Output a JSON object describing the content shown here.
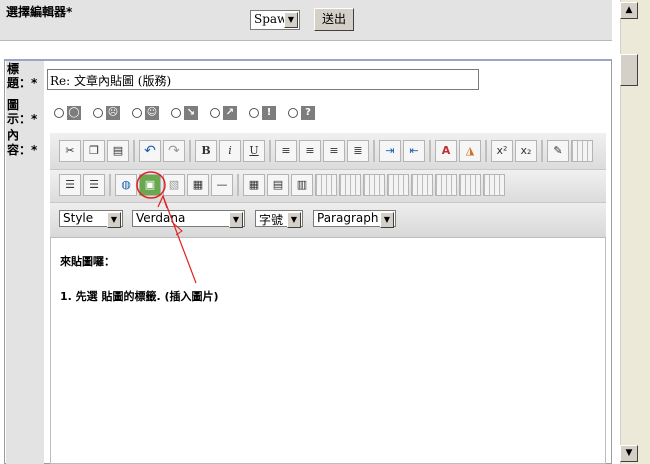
{
  "editor_row": {
    "label": "選擇編輯器*",
    "selected_editor": "Spaw",
    "submit_label": "送出"
  },
  "form": {
    "title_label_1": "標",
    "title_label_2": "題：*",
    "icon_label_1": "圖",
    "icon_label_2": "示：*",
    "content_label_1": "內",
    "content_label_2": "容：*",
    "title_value": "Re: 文章內貼圖 (版務)"
  },
  "icon_options": [
    "smile-face",
    "sad-face",
    "happy-face",
    "arrow-down-right",
    "arrow-up-right",
    "exclamation",
    "question"
  ],
  "toolbar": {
    "style_select": "Style",
    "font_select": "Verdana",
    "size_select": "字號",
    "format_select": "Paragraph",
    "bold": "B",
    "italic": "i",
    "underline": "U",
    "superscript": "x²",
    "subscript": "x₂"
  },
  "content": {
    "line1": "來貼圖囉：",
    "line2": "1. 先選 貼圖的標籤. (插入圖片)"
  },
  "annotation_color": "#e02020"
}
